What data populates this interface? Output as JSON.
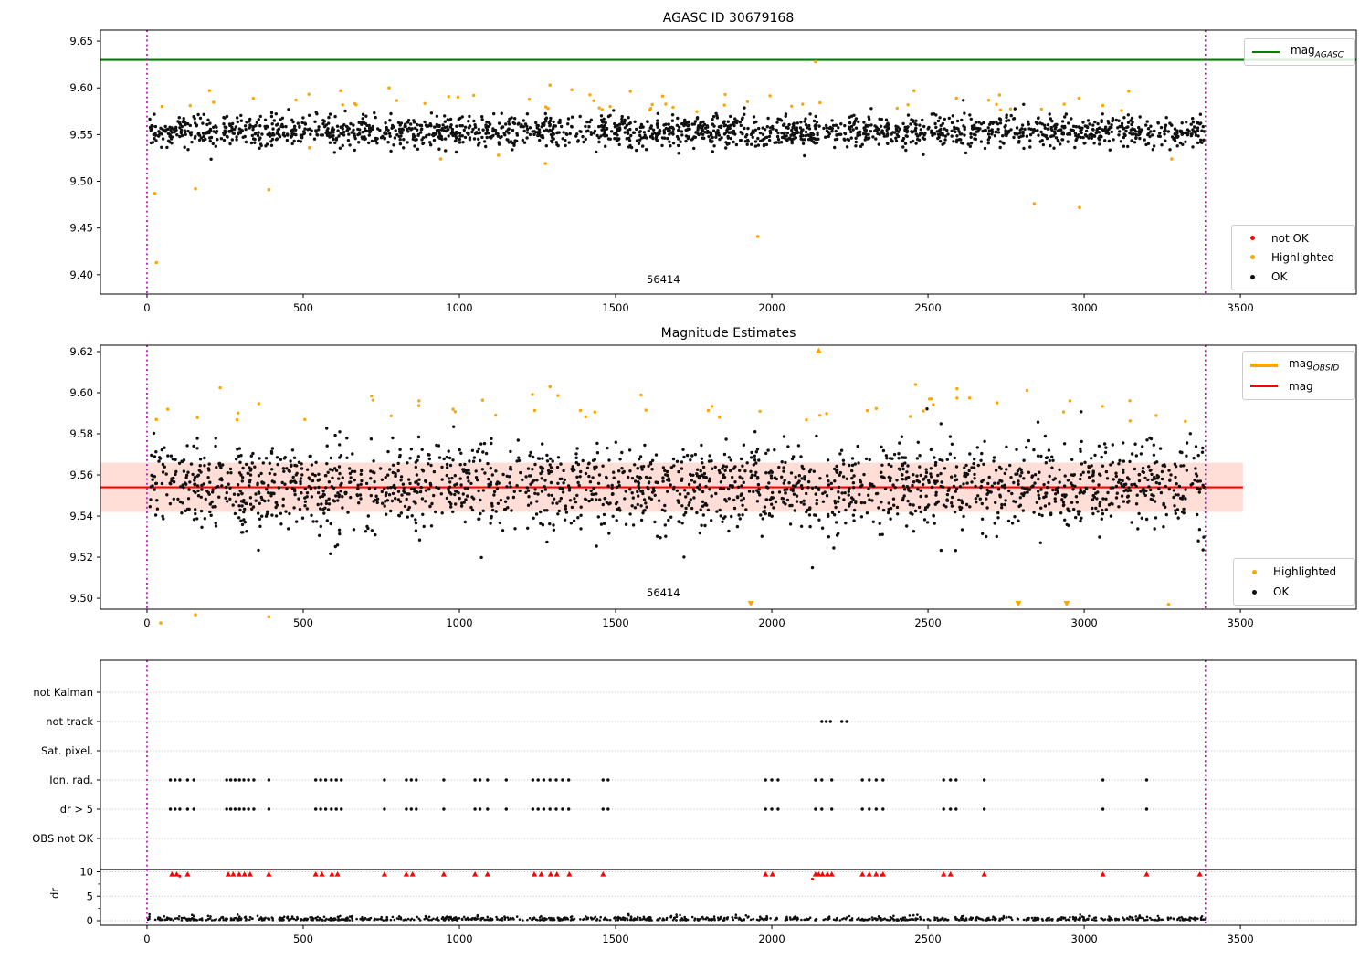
{
  "titles": {
    "panel1": "AGASC ID 30679168",
    "panel2": "Magnitude Estimates"
  },
  "annotations": {
    "panel1": "56414",
    "panel2": "56414"
  },
  "panel3_ylabel": "dr",
  "legends": {
    "p1_line": {
      "main": "mag",
      "sub": "AGASC"
    },
    "p1_markers": [
      {
        "label": "not OK",
        "color": "#ff0000"
      },
      {
        "label": "Highlighted",
        "color": "#ffa500"
      },
      {
        "label": "OK",
        "color": "#111111"
      }
    ],
    "p2_line1": {
      "main": "mag",
      "sub": "OBSID"
    },
    "p2_line2": {
      "main": "mag",
      "sub": ""
    },
    "p2_markers": [
      {
        "label": "Highlighted",
        "color": "#ffa500"
      },
      {
        "label": "OK",
        "color": "#111111"
      }
    ]
  },
  "colors": {
    "ok": "#111111",
    "highlighted": "#ffa500",
    "not_ok": "#ff0000",
    "mag_agasc_line": "#008000",
    "mag_line": "#ff0000",
    "mag_obsid_line": "#ffa500",
    "obsid_marker_line": "#bf00bf",
    "band_fill": "rgba(255,70,40,0.18)"
  },
  "chart_data": [
    {
      "id": "agasc_magnitudes",
      "type": "scatter",
      "title": "AGASC ID 30679168",
      "xlim": [
        -149,
        3871
      ],
      "ylim": [
        9.3793,
        9.6618
      ],
      "xticks": [
        0,
        500,
        1000,
        1500,
        2000,
        2500,
        3000,
        3500
      ],
      "yticks": [
        9.4,
        9.45,
        9.5,
        9.55,
        9.6,
        9.65
      ],
      "ytick_labels": [
        "9.40",
        "9.45",
        "9.50",
        "9.55",
        "9.60",
        "9.65"
      ],
      "hline": {
        "y": 9.63,
        "color": "#008000",
        "label": "mag_AGASC"
      },
      "vlines": [
        0,
        3388
      ],
      "vline_color": "#bf00bf",
      "annotation": "56414",
      "series": [
        {
          "name": "OK",
          "color": "#111111",
          "cloud": {
            "n": 1900,
            "seed": 42,
            "x": [
              5,
              3385
            ],
            "mean": 9.5535,
            "sd": 0.0085,
            "clip": [
              9.512,
              9.594
            ]
          },
          "points": []
        },
        {
          "name": "Highlighted",
          "color": "#ffa500",
          "cloud": {
            "n": 52,
            "seed": 77,
            "x": [
              20,
              3375
            ],
            "mean": 9.5845,
            "sd": 0.007,
            "clip": [
              9.573,
              9.601
            ]
          },
          "points": [
            [
              30,
              9.413
            ],
            [
              25,
              9.487
            ],
            [
              155,
              9.492
            ],
            [
              390,
              9.491
            ],
            [
              1955,
              9.441
            ],
            [
              2840,
              9.476
            ],
            [
              2985,
              9.472
            ],
            [
              1290,
              9.603
            ],
            [
              2140,
              9.628
            ],
            [
              520,
              9.536
            ],
            [
              1125,
              9.528
            ],
            [
              940,
              9.524
            ],
            [
              1275,
              9.519
            ],
            [
              3280,
              9.524
            ],
            [
              2455,
              9.597
            ],
            [
              620,
              9.597
            ],
            [
              775,
              9.6
            ],
            [
              1360,
              9.598
            ]
          ]
        },
        {
          "name": "not OK",
          "color": "#ff0000",
          "points": []
        }
      ]
    },
    {
      "id": "magnitude_estimates",
      "type": "scatter",
      "title": "Magnitude Estimates",
      "xlim": [
        -149,
        3871
      ],
      "ylim": [
        9.4947,
        9.6231
      ],
      "xticks": [
        0,
        500,
        1000,
        1500,
        2000,
        2500,
        3000,
        3500
      ],
      "yticks": [
        9.5,
        9.52,
        9.54,
        9.56,
        9.58,
        9.6,
        9.62
      ],
      "ytick_labels": [
        "9.50",
        "9.52",
        "9.54",
        "9.56",
        "9.58",
        "9.60",
        "9.62"
      ],
      "band": {
        "y": [
          9.542,
          9.566
        ],
        "x": [
          -149,
          3508
        ],
        "color": "rgba(255,70,40,0.18)"
      },
      "hline": {
        "y": 9.554,
        "x": [
          -149,
          3508
        ],
        "color": "#ff0000",
        "label": "mag"
      },
      "vlines": [
        0,
        3388
      ],
      "vline_color": "#bf00bf",
      "annotation": "56414",
      "series": [
        {
          "name": "OK",
          "color": "#111111",
          "cloud": {
            "n": 2000,
            "seed": 11,
            "x": [
              5,
              3385
            ],
            "mean": 9.5545,
            "sd": 0.0105,
            "clip": [
              9.5115,
              9.6
            ]
          },
          "points": []
        },
        {
          "name": "Highlighted",
          "color": "#ffa500",
          "cloud": {
            "n": 50,
            "seed": 5,
            "x": [
              20,
              3375
            ],
            "mean": 9.5915,
            "sd": 0.006,
            "clip": [
              9.583,
              9.606
            ]
          },
          "points": [
            [
              44,
              9.488
            ],
            [
              155,
              9.492
            ],
            [
              390,
              9.491
            ],
            [
              3270,
              9.497
            ],
            [
              2460,
              9.604
            ],
            [
              1290,
              9.603
            ],
            [
              30,
              9.587
            ]
          ],
          "clip_up": [
            2150
          ],
          "clip_down": [
            1933,
            2789,
            2944
          ]
        }
      ]
    },
    {
      "id": "flags_and_dr",
      "type": "flags",
      "xlim": [
        -149,
        3871
      ],
      "xticks": [
        0,
        500,
        1000,
        1500,
        2000,
        2500,
        3000,
        3500
      ],
      "rows": [
        "not Kalman",
        "not track",
        "Sat. pixel.",
        "Ion. rad.",
        "dr > 5",
        "OBS not OK"
      ],
      "dr_ticks": [
        0,
        5,
        10
      ],
      "ylabel": "dr",
      "vlines": [
        0,
        3388
      ],
      "vline_color": "#bf00bf",
      "flags": {
        "not Kalman": [],
        "not track": [
          2160,
          2174,
          2188,
          2224,
          2240
        ],
        "Sat. pixel.": [],
        "Ion. rad.": [
          75,
          90,
          105,
          130,
          150,
          255,
          268,
          282,
          296,
          310,
          325,
          342,
          390,
          540,
          556,
          572,
          590,
          606,
          622,
          760,
          830,
          846,
          862,
          950,
          1050,
          1066,
          1090,
          1150,
          1235,
          1252,
          1270,
          1290,
          1310,
          1330,
          1350,
          1460,
          1476,
          1980,
          2000,
          2020,
          2140,
          2160,
          2192,
          2290,
          2312,
          2334,
          2356,
          2550,
          2572,
          2590,
          2680,
          3060,
          3200
        ],
        "dr > 5": [
          75,
          90,
          105,
          130,
          150,
          255,
          268,
          282,
          296,
          310,
          325,
          342,
          390,
          540,
          556,
          572,
          590,
          606,
          622,
          760,
          830,
          846,
          862,
          950,
          1050,
          1066,
          1090,
          1150,
          1235,
          1252,
          1270,
          1290,
          1310,
          1330,
          1350,
          1460,
          1476,
          1980,
          2000,
          2020,
          2140,
          2160,
          2192,
          2290,
          2312,
          2334,
          2356,
          2550,
          2572,
          2590,
          2680,
          3060,
          3200
        ],
        "OBS not OK": []
      },
      "red_clipped_x": [
        80,
        95,
        130,
        260,
        276,
        295,
        312,
        330,
        390,
        540,
        560,
        592,
        610,
        760,
        830,
        850,
        950,
        1050,
        1090,
        1240,
        1262,
        1292,
        1312,
        1352,
        1460,
        1980,
        2002,
        2140,
        2150,
        2162,
        2178,
        2192,
        2290,
        2312,
        2334,
        2356,
        2550,
        2572,
        2680,
        3060,
        3200,
        3370
      ],
      "red_points": [
        [
          105,
          9.1
        ],
        [
          2130,
          8.5
        ],
        [
          2352,
          9.3
        ]
      ],
      "dr_trace": {
        "n": 1000,
        "seed": 3,
        "x": [
          3,
          3388
        ],
        "base": 0.07,
        "scale": 0.4,
        "max": 2.6
      }
    }
  ]
}
